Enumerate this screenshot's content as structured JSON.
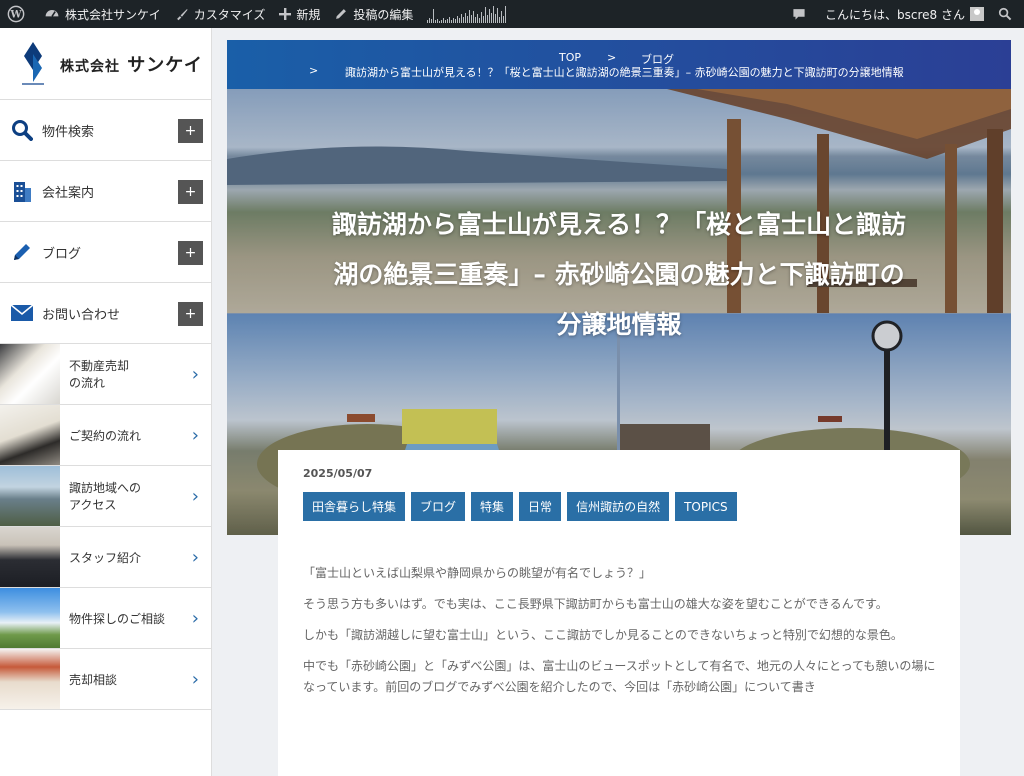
{
  "adminbar": {
    "site_name": "株式会社サンケイ",
    "customize": "カスタマイズ",
    "new": "新規",
    "edit_post": "投稿の編集",
    "greeting": "こんにちは、bscre8 さん"
  },
  "sidebar": {
    "logo_prefix": "株式会社",
    "logo_name": "サンケイ",
    "menu": [
      {
        "label": "物件検索",
        "icon": "search-icon"
      },
      {
        "label": "会社案内",
        "icon": "building-icon"
      },
      {
        "label": "ブログ",
        "icon": "pencil-icon"
      },
      {
        "label": "お問い合わせ",
        "icon": "mail-icon"
      }
    ],
    "plus_label": "+",
    "links": [
      {
        "label_line1": "不動産売却",
        "label_line2": "の流れ"
      },
      {
        "label_line1": "ご契約の流れ",
        "label_line2": ""
      },
      {
        "label_line1": "諏訪地域への",
        "label_line2": "アクセス"
      },
      {
        "label_line1": "スタッフ紹介",
        "label_line2": ""
      },
      {
        "label_line1": "物件探しのご相談",
        "label_line2": ""
      },
      {
        "label_line1": "売却相談",
        "label_line2": ""
      }
    ],
    "chevron": "›"
  },
  "breadcrumb": {
    "top": "TOP",
    "sep": ">",
    "blog": "ブログ",
    "current": "諏訪湖から富士山が見える！？「桜と富士山と諏訪湖の絶景三重奏」– 赤砂崎公園の魅力と下諏訪町の分譲地情報"
  },
  "hero": {
    "title_line1": "諏訪湖から富士山が見える！？「桜と富士山と諏訪",
    "title_line2": "湖の絶景三重奏」– 赤砂崎公園の魅力と下諏訪町の",
    "title_line3": "分譲地情報"
  },
  "article": {
    "date": "2025/05/07",
    "tags": [
      "田舎暮らし特集",
      "ブログ",
      "特集",
      "日常",
      "信州諏訪の自然",
      "TOPICS"
    ],
    "p1": "「富士山といえば山梨県や静岡県からの眺望が有名でしょう？」",
    "p2": "そう思う方も多いはず。でも実は、ここ長野県下諏訪町からも富士山の雄大な姿を望むことができるんです。",
    "p3": "しかも「諏訪湖越しに望む富士山」という、ここ諏訪でしか見ることのできないちょっと特別で幻想的な景色。",
    "p4": "中でも「赤砂崎公園」と「みずべ公園」は、富士山のビュースポットとして有名で、地元の人々にとっても憩いの場になっています。前回のブログでみずべ公園を紹介したので、今回は「赤砂崎公園」について書き"
  }
}
